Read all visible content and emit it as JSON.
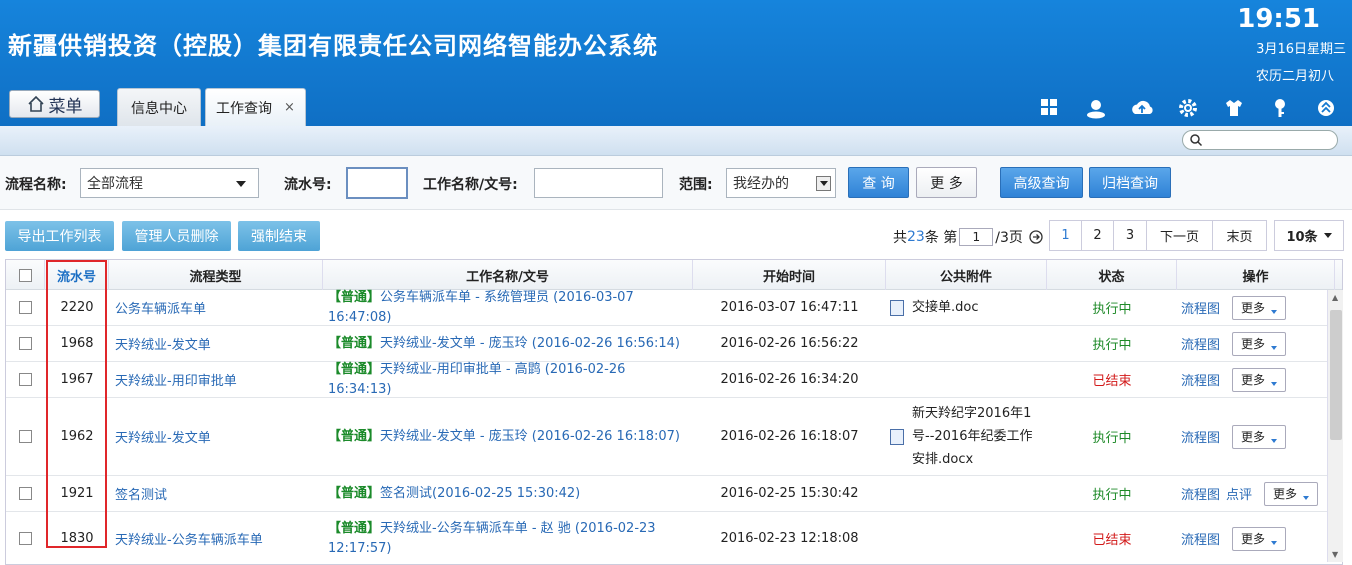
{
  "header": {
    "app_title": "新疆供销投资（控股）集团有限责任公司网络智能办公系统",
    "clock": "19:51",
    "date": "3月16日星期三",
    "lunar": "农历二月初八",
    "menu_label": "菜单"
  },
  "tabs": [
    {
      "label": "信息中心"
    },
    {
      "label": "工作查询",
      "close": "×"
    }
  ],
  "toolbar_icons": [
    "apps-icon",
    "user-icon",
    "cloud-upload-icon",
    "gear-icon",
    "shirt-icon",
    "key-icon",
    "collapse-icon"
  ],
  "filters": {
    "flow_name_label": "流程名称:",
    "flow_name_value": "全部流程",
    "serial_label": "流水号:",
    "serial_value": "",
    "work_name_label": "工作名称/文号:",
    "work_name_value": "",
    "scope_label": "范围:",
    "scope_value": "我经办的",
    "query_button": "查 询",
    "more_button": "更 多",
    "advanced_button": "高级查询",
    "archive_button": "归档查询"
  },
  "actions": {
    "export": "导出工作列表",
    "admin_delete": "管理人员删除",
    "force_end": "强制结束"
  },
  "pager": {
    "total_prefix": "共",
    "total": "23",
    "total_suffix": "条 第",
    "current": "1",
    "pages_suffix": "/3页",
    "pages": [
      "1",
      "2",
      "3"
    ],
    "next": "下一页",
    "last": "末页",
    "page_size": "10条"
  },
  "columns": [
    "流水号",
    "流程类型",
    "工作名称/文号",
    "开始时间",
    "公共附件",
    "状态",
    "操作"
  ],
  "rows": [
    {
      "id": "2220",
      "type": "公务车辆派车单",
      "prio": "【普通】",
      "title": "公务车辆派车单 - 系统管理员 (2016-03-07 16:47:08)",
      "start": "2016-03-07 16:47:11",
      "attachment": "交接单.doc",
      "status": "执行中",
      "status_kind": "run",
      "ops": [
        "流程图"
      ],
      "more": "更多"
    },
    {
      "id": "1968",
      "type": "天羚绒业-发文单",
      "prio": "【普通】",
      "title": "天羚绒业-发文单 - 庞玉玲 (2016-02-26 16:56:14)",
      "start": "2016-02-26 16:56:22",
      "attachment": "",
      "status": "执行中",
      "status_kind": "run",
      "ops": [
        "流程图"
      ],
      "more": "更多"
    },
    {
      "id": "1967",
      "type": "天羚绒业-用印审批单",
      "prio": "【普通】",
      "title": "天羚绒业-用印审批单 - 高鹍 (2016-02-26 16:34:13)",
      "start": "2016-02-26 16:34:20",
      "attachment": "",
      "status": "已结束",
      "status_kind": "end",
      "ops": [
        "流程图"
      ],
      "more": "更多"
    },
    {
      "id": "1962",
      "type": "天羚绒业-发文单",
      "prio": "【普通】",
      "title": "天羚绒业-发文单 - 庞玉玲 (2016-02-26 16:18:07)",
      "start": "2016-02-26 16:18:07",
      "attachment": "新天羚纪字2016年1号--2016年纪委工作安排.docx",
      "status": "执行中",
      "status_kind": "run",
      "ops": [
        "流程图"
      ],
      "more": "更多"
    },
    {
      "id": "1921",
      "type": "签名测试",
      "prio": "【普通】",
      "title": "签名测试(2016-02-25 15:30:42)",
      "start": "2016-02-25 15:30:42",
      "attachment": "",
      "status": "执行中",
      "status_kind": "run",
      "ops": [
        "流程图",
        "点评"
      ],
      "more": "更多"
    },
    {
      "id": "1830",
      "type": "天羚绒业-公务车辆派车单",
      "prio": "【普通】",
      "title": "天羚绒业-公务车辆派车单 - 赵  驰 (2016-02-23 12:17:57)",
      "start": "2016-02-23 12:18:08",
      "attachment": "",
      "status": "已结束",
      "status_kind": "end",
      "ops": [
        "流程图"
      ],
      "more": "更多"
    }
  ]
}
